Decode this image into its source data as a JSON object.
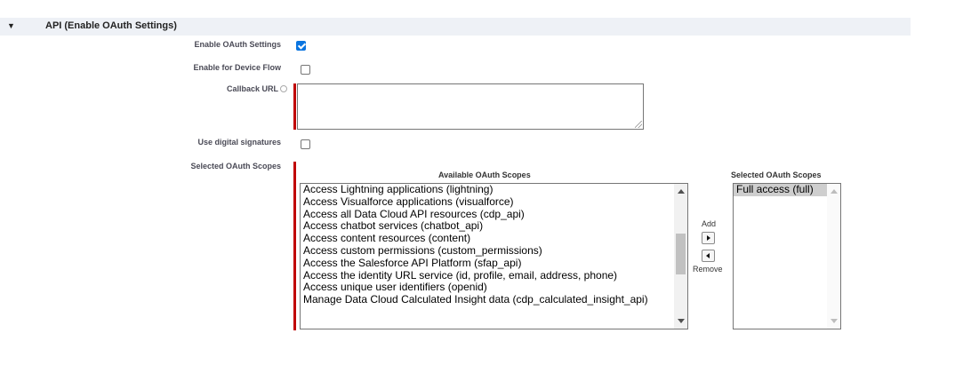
{
  "section": {
    "title": "API (Enable OAuth Settings)",
    "toggle_glyph": "▼"
  },
  "fields": {
    "enable_oauth": {
      "label": "Enable OAuth Settings",
      "checked": true
    },
    "device_flow": {
      "label": "Enable for Device Flow",
      "checked": false
    },
    "callback_url": {
      "label": "Callback URL",
      "value": ""
    },
    "digital_signatures": {
      "label": "Use digital signatures",
      "checked": false
    },
    "oauth_scopes": {
      "label": "Selected OAuth Scopes"
    }
  },
  "scopes": {
    "available_title": "Available OAuth Scopes",
    "selected_title": "Selected OAuth Scopes",
    "available": [
      "Access Lightning applications (lightning)",
      "Access Visualforce applications (visualforce)",
      "Access all Data Cloud API resources (cdp_api)",
      "Access chatbot services (chatbot_api)",
      "Access content resources (content)",
      "Access custom permissions (custom_permissions)",
      "Access the Salesforce API Platform (sfap_api)",
      "Access the identity URL service (id, profile, email, address, phone)",
      "Access unique user identifiers (openid)",
      "Manage Data Cloud Calculated Insight data (cdp_calculated_insight_api)"
    ],
    "selected": [
      "Full access (full)"
    ],
    "add_label": "Add",
    "remove_label": "Remove"
  },
  "colors": {
    "required": "#c00000",
    "checkbox": "#0b75e0",
    "header_bg": "#eef1f6"
  },
  "icons": {
    "toggle": "triangle-down-icon",
    "info": "info-icon",
    "add": "arrow-right-icon",
    "remove": "arrow-left-icon"
  }
}
